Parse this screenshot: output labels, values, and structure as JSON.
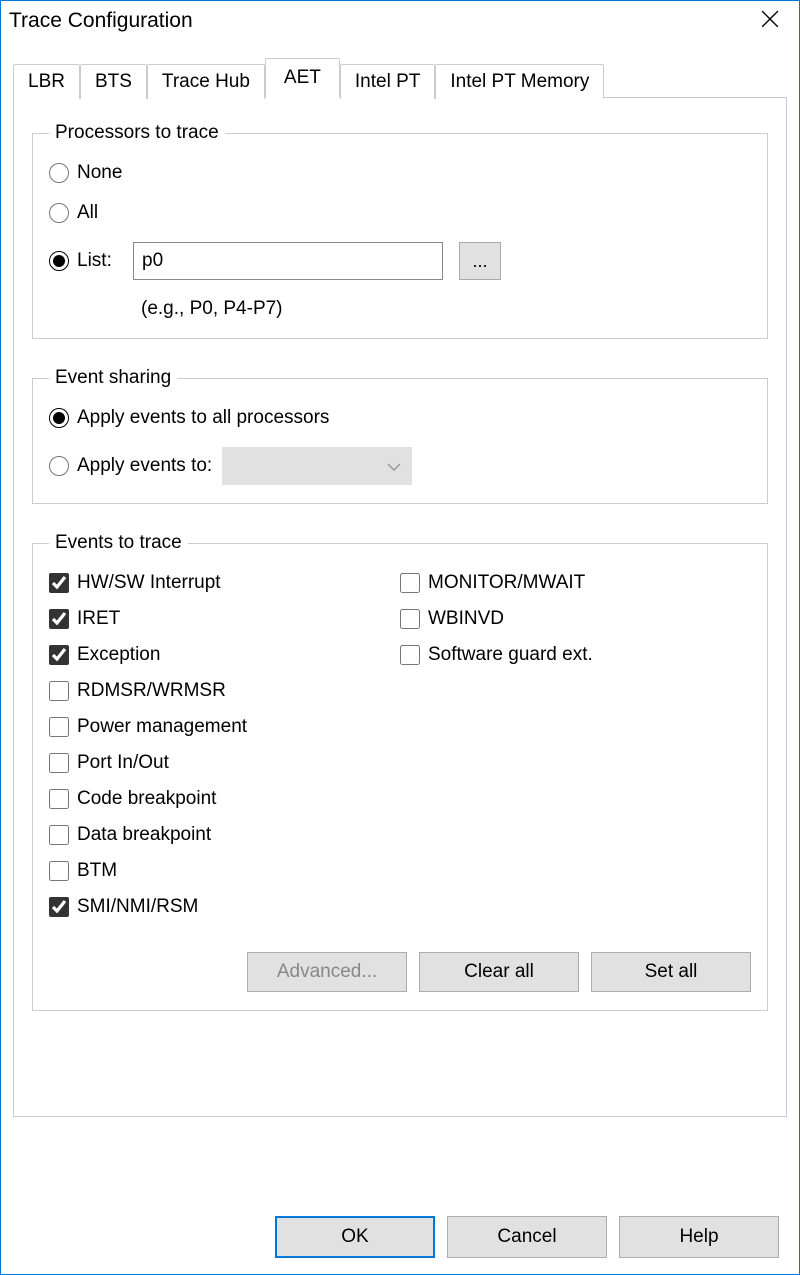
{
  "window": {
    "title": "Trace Configuration"
  },
  "tabs": [
    {
      "label": "LBR",
      "active": false
    },
    {
      "label": "BTS",
      "active": false
    },
    {
      "label": "Trace Hub",
      "active": false
    },
    {
      "label": "AET",
      "active": true
    },
    {
      "label": "Intel PT",
      "active": false
    },
    {
      "label": "Intel PT Memory",
      "active": false
    }
  ],
  "processors": {
    "legend": "Processors to trace",
    "options": {
      "none": "None",
      "all": "All",
      "list": "List:"
    },
    "selected": "list",
    "list_value": "p0",
    "browse": "...",
    "hint": "(e.g., P0, P4-P7)"
  },
  "event_sharing": {
    "legend": "Event sharing",
    "apply_all": "Apply events to all processors",
    "apply_to": "Apply events to:",
    "selected": "all"
  },
  "events": {
    "legend": "Events to trace",
    "left": [
      {
        "label": "HW/SW Interrupt",
        "checked": true
      },
      {
        "label": "IRET",
        "checked": true
      },
      {
        "label": "Exception",
        "checked": true
      },
      {
        "label": "RDMSR/WRMSR",
        "checked": false
      },
      {
        "label": "Power management",
        "checked": false
      },
      {
        "label": "Port In/Out",
        "checked": false
      },
      {
        "label": "Code breakpoint",
        "checked": false
      },
      {
        "label": "Data breakpoint",
        "checked": false
      },
      {
        "label": "BTM",
        "checked": false
      },
      {
        "label": "SMI/NMI/RSM",
        "checked": true
      }
    ],
    "right": [
      {
        "label": "MONITOR/MWAIT",
        "checked": false
      },
      {
        "label": "WBINVD",
        "checked": false
      },
      {
        "label": "Software guard ext.",
        "checked": false
      }
    ],
    "buttons": {
      "advanced": "Advanced...",
      "clear_all": "Clear all",
      "set_all": "Set all"
    }
  },
  "dialog_buttons": {
    "ok": "OK",
    "cancel": "Cancel",
    "help": "Help"
  }
}
